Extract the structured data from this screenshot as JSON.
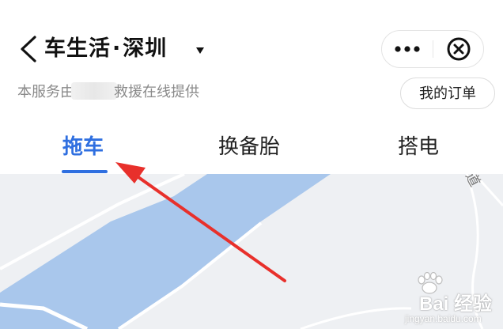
{
  "header": {
    "title_service": "车生活",
    "title_separator": "·",
    "title_city": "深圳",
    "subtitle_prefix": "本服务由",
    "subtitle_suffix": "救援在线提供",
    "order_button": "我的订单"
  },
  "tabs": [
    {
      "label": "拖车",
      "active": true
    },
    {
      "label": "换备胎",
      "active": false
    },
    {
      "label": "搭电",
      "active": false
    }
  ],
  "map": {
    "road_label": "道"
  },
  "watermark": {
    "logo": "Bai  经验",
    "url": "jingyan.baidu.com"
  },
  "colors": {
    "accent": "#2f6fe0",
    "river": "#a9c7ec",
    "map_background": "#eef0f3",
    "annotation_arrow": "#e8302b"
  },
  "icons": {
    "back": "chevron-left-icon",
    "city_dropdown": "caret-down-icon",
    "more": "more-dots-icon",
    "close": "close-circle-icon"
  }
}
